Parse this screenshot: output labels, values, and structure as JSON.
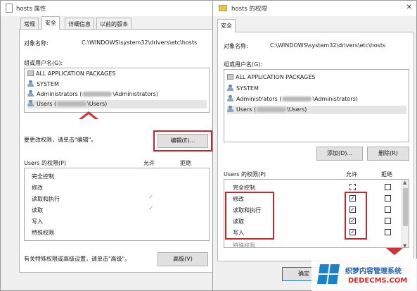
{
  "left_dialog": {
    "title": "hosts 属性",
    "tabs": [
      "常规",
      "安全",
      "详细信息",
      "以前的版本"
    ],
    "object_label": "对象名称:",
    "object_value": "C:\\WINDOWS\\system32\\drivers\\etc\\hosts",
    "group_label": "组或用户名(G):",
    "groups": [
      {
        "name": "ALL APPLICATION PACKAGES",
        "icon": "package-icon"
      },
      {
        "name": "SYSTEM",
        "icon": "users-icon"
      },
      {
        "prefix": "Administrators (",
        "suffix": "\\Administrators)",
        "icon": "users-icon"
      },
      {
        "prefix": "Users (",
        "suffix": "\\Users)",
        "icon": "users-icon",
        "selected": true
      }
    ],
    "edit_hint": "要更改权限，请单击\"编辑\"。",
    "edit_button": "编辑(E)...",
    "perm_label": "Users 的权限(P)",
    "allow": "允许",
    "deny": "拒绝",
    "permissions": [
      {
        "name": "完全控制",
        "allow": false
      },
      {
        "name": "修改",
        "allow": false
      },
      {
        "name": "读取和执行",
        "allow": true
      },
      {
        "name": "读取",
        "allow": true
      },
      {
        "name": "写入",
        "allow": false
      },
      {
        "name": "特殊权限",
        "allow": false
      }
    ],
    "advanced_hint": "有关特殊权限或高级设置，请单击\"高级\"。",
    "advanced_button": "高级(V)"
  },
  "right_dialog": {
    "title": "hosts 的权限",
    "tab": "安全",
    "object_label": "对象名称:",
    "object_value": "C:\\WINDOWS\\system32\\drivers\\etc\\hosts",
    "group_label": "组或用户名(G):",
    "groups": [
      {
        "name": "ALL APPLICATION PACKAGES",
        "icon": "package-icon"
      },
      {
        "name": "SYSTEM",
        "icon": "users-icon"
      },
      {
        "prefix": "Administrators (",
        "suffix": "\\Administrators)",
        "icon": "users-icon"
      },
      {
        "prefix": "Users (",
        "suffix": "\\Users)",
        "icon": "users-icon",
        "selected": true
      }
    ],
    "add_button": "添加(D)...",
    "remove_button": "删除(R)",
    "perm_label": "Users 的权限(P)",
    "allow": "允许",
    "deny": "拒绝",
    "permissions": [
      {
        "name": "完全控制",
        "allow": false,
        "deny": false
      },
      {
        "name": "修改",
        "allow": true,
        "deny": false
      },
      {
        "name": "读取和执行",
        "allow": true,
        "deny": false
      },
      {
        "name": "读取",
        "allow": true,
        "deny": false
      },
      {
        "name": "写入",
        "allow": true,
        "deny": false
      }
    ],
    "partial_row": "特殊权限",
    "ok_button": "确定"
  },
  "watermark": {
    "line1": "织梦内容管理系统",
    "line2": "DEDECMS.COM"
  },
  "colors": {
    "highlight_red": "#c8262e",
    "arrow_red": "#d43137",
    "dialog_bg": "#f0f0f0",
    "panel_bg": "#ffffff",
    "primary_border": "#2f6fb4"
  }
}
